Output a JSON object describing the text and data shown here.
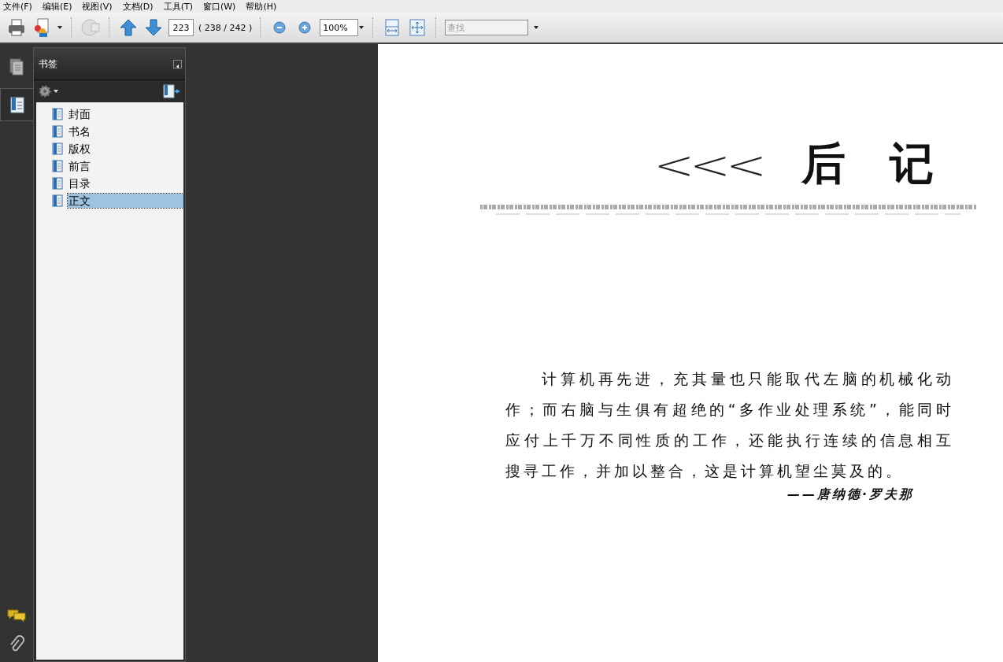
{
  "menu": [
    "文件(F)",
    "编辑(E)",
    "视图(V)",
    "文档(D)",
    "工具(T)",
    "窗口(W)",
    "帮助(H)"
  ],
  "toolbar": {
    "page_number": "223",
    "page_count": "( 238 / 242 )",
    "zoom": "100%",
    "search": {
      "placeholder": "查找"
    }
  },
  "nav_tabs": [
    {
      "kind": "pages",
      "selected": false
    },
    {
      "kind": "bookmarks",
      "selected": true
    }
  ],
  "bookmarks_panel": {
    "title": "书签",
    "items": [
      {
        "label": "封面",
        "selected": false
      },
      {
        "label": "书名",
        "selected": false
      },
      {
        "label": "版权",
        "selected": false
      },
      {
        "label": "前言",
        "selected": false
      },
      {
        "label": "目录",
        "selected": false
      },
      {
        "label": "正文",
        "selected": true
      }
    ]
  },
  "page": {
    "chevrons": "<<<",
    "heading": "后　记",
    "paragraph": "计算机再先进，充其量也只能取代左脑的机械化动作；而右脑与生俱有超绝的“多作业处理系统”，能同时应付上千万不同性质的工作，还能执行连续的信息相互搜寻工作，并加以整合，这是计算机望尘莫及的。",
    "attribution": "——唐纳德·罗夫那"
  }
}
